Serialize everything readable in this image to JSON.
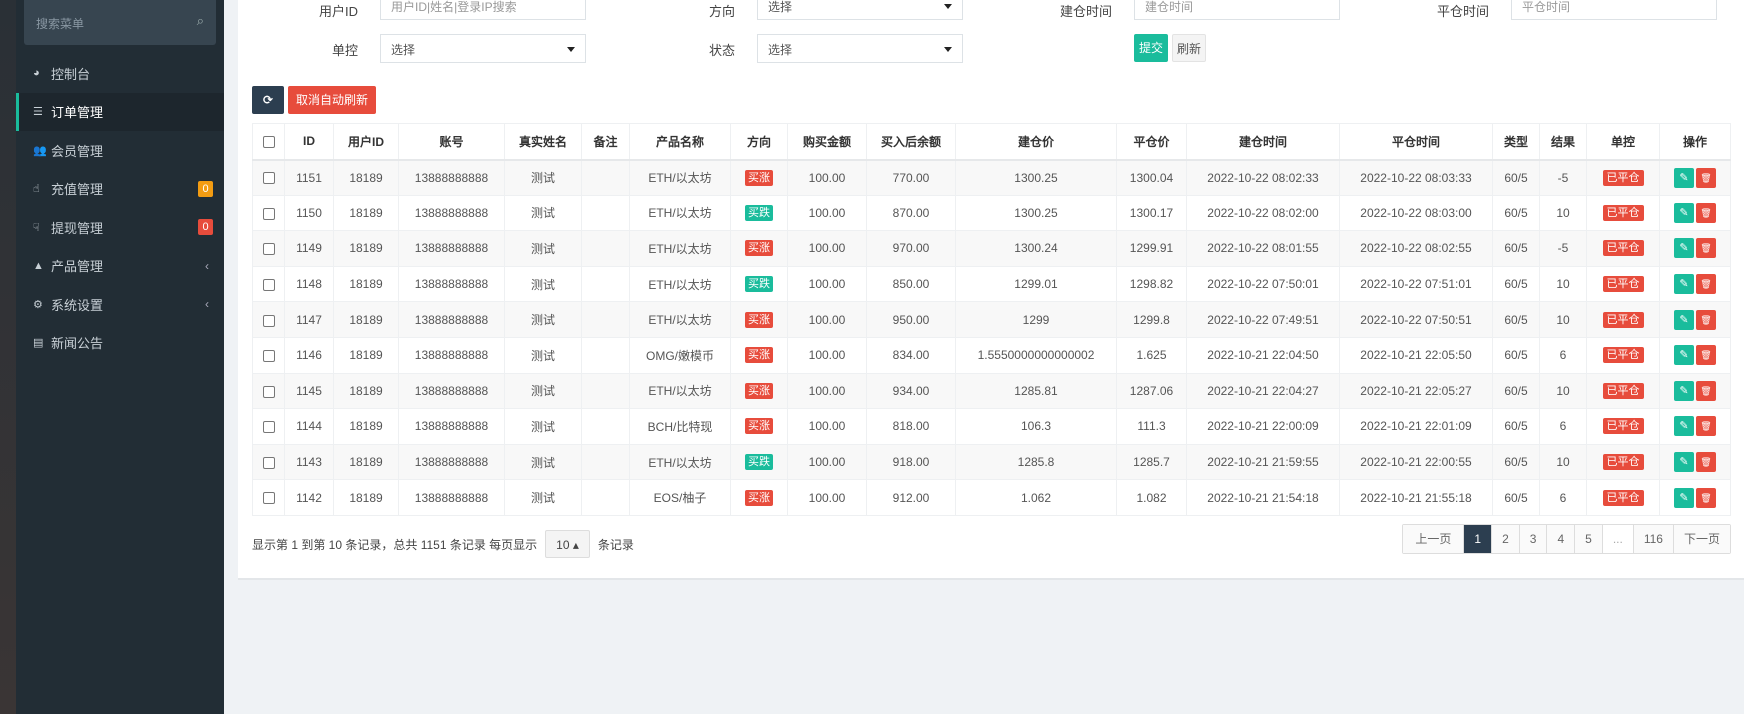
{
  "sidebar": {
    "search_placeholder": "搜索菜单",
    "items": [
      {
        "label": "控制台",
        "icon": "dashboard-icon",
        "glyph": "◕"
      },
      {
        "label": "订单管理",
        "icon": "list-icon",
        "glyph": "☰",
        "active": true
      },
      {
        "label": "会员管理",
        "icon": "users-icon",
        "glyph": "👥"
      },
      {
        "label": "充值管理",
        "icon": "hand-point-up-icon",
        "glyph": "☝",
        "badge": "0",
        "badge_color": "#f39c12"
      },
      {
        "label": "提现管理",
        "icon": "hand-point-down-icon",
        "glyph": "☟",
        "badge": "0",
        "badge_color": "#e74c3c"
      },
      {
        "label": "产品管理",
        "icon": "shopping-bag-icon",
        "glyph": "▲",
        "chevron": true
      },
      {
        "label": "系统设置",
        "icon": "gears-icon",
        "glyph": "⚙",
        "chevron": true
      },
      {
        "label": "新闻公告",
        "icon": "newspaper-icon",
        "glyph": "▤"
      }
    ]
  },
  "filters": {
    "user_id_label": "用户ID",
    "user_id_placeholder": "用户ID|姓名|登录IP搜索",
    "direction_label": "方向",
    "direction_value": "选择",
    "open_time_label": "建仓时间",
    "open_time_placeholder": "建仓时间",
    "close_time_label": "平仓时间",
    "close_time_placeholder": "平仓时间",
    "control_label": "单控",
    "control_value": "选择",
    "status_label": "状态",
    "status_value": "选择",
    "submit": "提交",
    "refresh": "刷新"
  },
  "toolbar": {
    "cancel_auto_refresh": "取消自动刷新"
  },
  "colors": {
    "red": "#e74c3c",
    "green": "#1abc9c",
    "navy": "#2c3e50"
  },
  "table": {
    "headers": [
      "ID",
      "用户ID",
      "账号",
      "真实姓名",
      "备注",
      "产品名称",
      "方向",
      "购买金额",
      "买入后余额",
      "建仓价",
      "平仓价",
      "建仓时间",
      "平仓时间",
      "类型",
      "结果",
      "单控",
      "操作"
    ],
    "rows": [
      [
        "1151",
        "18189",
        "13888888888",
        "测试",
        "",
        "ETH/以太坊",
        "买涨",
        "100.00",
        "770.00",
        "1300.25",
        "1300.04",
        "2022-10-22 08:02:33",
        "2022-10-22 08:03:33",
        "60/5",
        "-5",
        "已平仓"
      ],
      [
        "1150",
        "18189",
        "13888888888",
        "测试",
        "",
        "ETH/以太坊",
        "买跌",
        "100.00",
        "870.00",
        "1300.25",
        "1300.17",
        "2022-10-22 08:02:00",
        "2022-10-22 08:03:00",
        "60/5",
        "10",
        "已平仓"
      ],
      [
        "1149",
        "18189",
        "13888888888",
        "测试",
        "",
        "ETH/以太坊",
        "买涨",
        "100.00",
        "970.00",
        "1300.24",
        "1299.91",
        "2022-10-22 08:01:55",
        "2022-10-22 08:02:55",
        "60/5",
        "-5",
        "已平仓"
      ],
      [
        "1148",
        "18189",
        "13888888888",
        "测试",
        "",
        "ETH/以太坊",
        "买跌",
        "100.00",
        "850.00",
        "1299.01",
        "1298.82",
        "2022-10-22 07:50:01",
        "2022-10-22 07:51:01",
        "60/5",
        "10",
        "已平仓"
      ],
      [
        "1147",
        "18189",
        "13888888888",
        "测试",
        "",
        "ETH/以太坊",
        "买涨",
        "100.00",
        "950.00",
        "1299",
        "1299.8",
        "2022-10-22 07:49:51",
        "2022-10-22 07:50:51",
        "60/5",
        "10",
        "已平仓"
      ],
      [
        "1146",
        "18189",
        "13888888888",
        "测试",
        "",
        "OMG/嫩模币",
        "买涨",
        "100.00",
        "834.00",
        "1.5550000000000002",
        "1.625",
        "2022-10-21 22:04:50",
        "2022-10-21 22:05:50",
        "60/5",
        "6",
        "已平仓"
      ],
      [
        "1145",
        "18189",
        "13888888888",
        "测试",
        "",
        "ETH/以太坊",
        "买涨",
        "100.00",
        "934.00",
        "1285.81",
        "1287.06",
        "2022-10-21 22:04:27",
        "2022-10-21 22:05:27",
        "60/5",
        "10",
        "已平仓"
      ],
      [
        "1144",
        "18189",
        "13888888888",
        "测试",
        "",
        "BCH/比特现",
        "买涨",
        "100.00",
        "818.00",
        "106.3",
        "111.3",
        "2022-10-21 22:00:09",
        "2022-10-21 22:01:09",
        "60/5",
        "6",
        "已平仓"
      ],
      [
        "1143",
        "18189",
        "13888888888",
        "测试",
        "",
        "ETH/以太坊",
        "买跌",
        "100.00",
        "918.00",
        "1285.8",
        "1285.7",
        "2022-10-21 21:59:55",
        "2022-10-21 22:00:55",
        "60/5",
        "10",
        "已平仓"
      ],
      [
        "1142",
        "18189",
        "13888888888",
        "测试",
        "",
        "EOS/柚子",
        "买涨",
        "100.00",
        "912.00",
        "1.062",
        "1.082",
        "2022-10-21 21:54:18",
        "2022-10-21 21:55:18",
        "60/5",
        "6",
        "已平仓"
      ]
    ]
  },
  "footer": {
    "info": "显示第 1 到第 10 条记录，总共 1151 条记录 每页显示",
    "page_size": "10",
    "page_size_suffix": "条记录"
  },
  "pagination": [
    "上一页",
    "1",
    "2",
    "3",
    "4",
    "5",
    "...",
    "116",
    "下一页"
  ],
  "pagination_current": "1"
}
